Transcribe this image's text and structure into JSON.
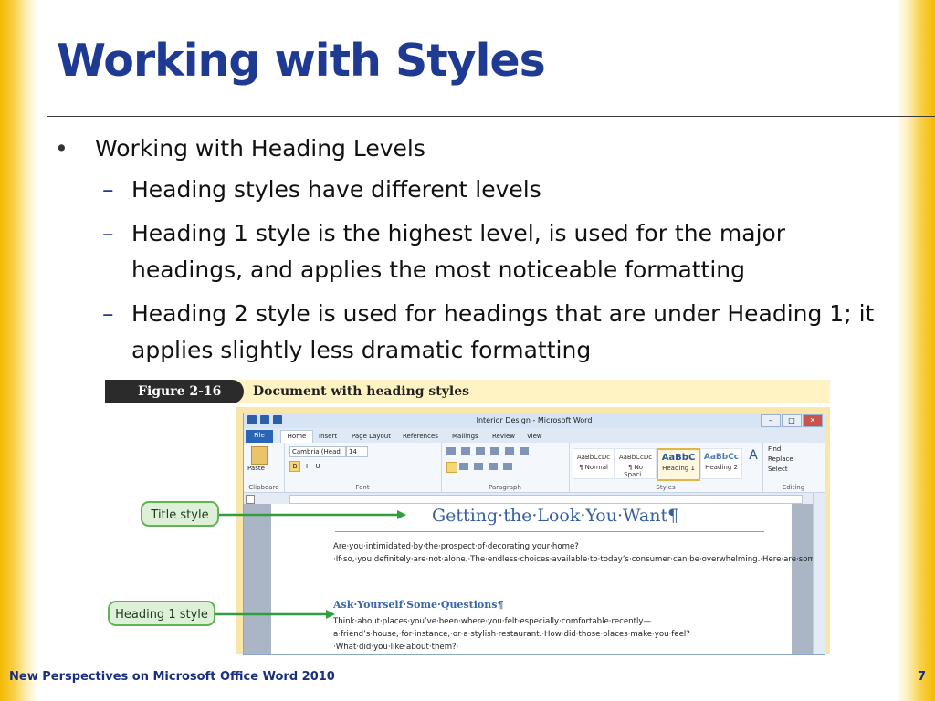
{
  "slide": {
    "title": "Working with Styles",
    "bullets": [
      {
        "text": "Working with Heading Levels",
        "children": [
          "Heading styles have different levels",
          "Heading 1 style is the highest level, is used for the major headings, and applies the most noticeable formatting",
          "Heading 2 style is used for headings that are under Heading 1; it applies slightly less dramatic formatting"
        ]
      }
    ],
    "bullet_mark": "•",
    "sub_mark": "–"
  },
  "figure": {
    "label": "Figure 2-16",
    "caption": "Document with heading styles",
    "callouts": [
      "Title style",
      "Heading 1 style"
    ],
    "word": {
      "window_title": "Interior Design - Microsoft Word",
      "tabs": [
        "File",
        "Home",
        "Insert",
        "Page Layout",
        "References",
        "Mailings",
        "Review",
        "View"
      ],
      "groups": [
        "Clipboard",
        "Font",
        "Paragraph",
        "Styles",
        "Editing"
      ],
      "paste_label": "Paste",
      "font_name": "Cambria (Headi",
      "font_size": "14",
      "format_buttons": [
        "B",
        "I",
        "U"
      ],
      "styles": [
        {
          "preview": "AaBbCcDc",
          "name": "¶ Normal"
        },
        {
          "preview": "AaBbCcDc",
          "name": "¶ No Spaci..."
        },
        {
          "preview": "AaBbC",
          "name": "Heading 1"
        },
        {
          "preview": "AaBbCc",
          "name": "Heading 2"
        }
      ],
      "change_styles": "Change Styles",
      "editing_items": [
        "Find",
        "Replace",
        "Select"
      ],
      "doc_title": "Getting·the·Look·You·Want¶",
      "doc_para1": "Are·you·intimidated·by·the·prospect·of·decorating·your·home?·If·so,·you·definitely·are·not·alone.·The·endless·choices·available·to·today’s·consumer·can·be·overwhelming.·Here·are·some·suggestions·from·Pembrooke·Community·College·design·students·to·help·you·get·started.¶",
      "doc_heading1": "Ask·Yourself·Some·Questions¶",
      "doc_para2": "Think·about·places·you’ve·been·where·you·felt·especially·comfortable·recently—a·friend’s·house,·for·instance,·or·a·stylish·restaurant.·How·did·those·places·make·you·feel?·What·did·you·like·about·them?·"
    }
  },
  "footer": {
    "left": "New Perspectives on Microsoft Office Word 2010",
    "page": "7"
  },
  "colors": {
    "title": "#1f3a93",
    "accent_gold": "#f4b900",
    "callout_fill": "#dff0d9",
    "callout_border": "#62b256"
  }
}
